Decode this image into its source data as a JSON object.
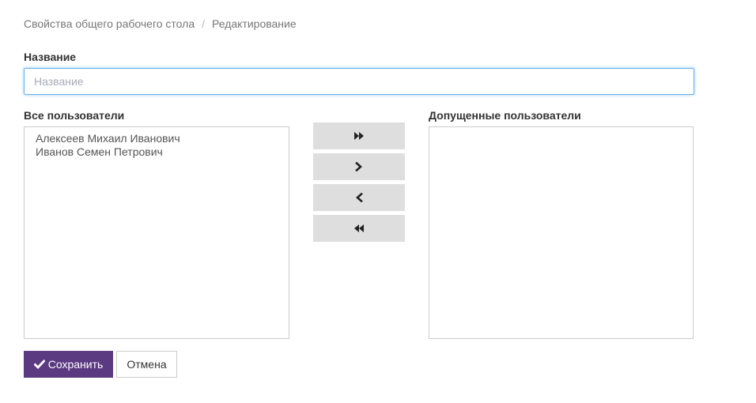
{
  "breadcrumb": {
    "items": [
      "Свойства общего рабочего стола",
      "Редактирование"
    ],
    "separator": "/"
  },
  "form": {
    "name_label": "Название",
    "name_placeholder": "Название",
    "name_value": "",
    "all_users_label": "Все пользователи",
    "allowed_users_label": "Допущенные пользователи",
    "all_users": [
      "Алексеев Михаил Иванович",
      "Иванов Семен Петрович"
    ],
    "allowed_users": []
  },
  "transfer_buttons": {
    "icons": [
      "double-chevron-right-icon",
      "chevron-right-icon",
      "chevron-left-icon",
      "double-chevron-left-icon"
    ]
  },
  "actions": {
    "save_label": "Сохранить",
    "cancel_label": "Отмена"
  },
  "colors": {
    "accent": "#5b3a82",
    "focus_border": "#66afe9",
    "transfer_button_bg": "#dedede"
  }
}
